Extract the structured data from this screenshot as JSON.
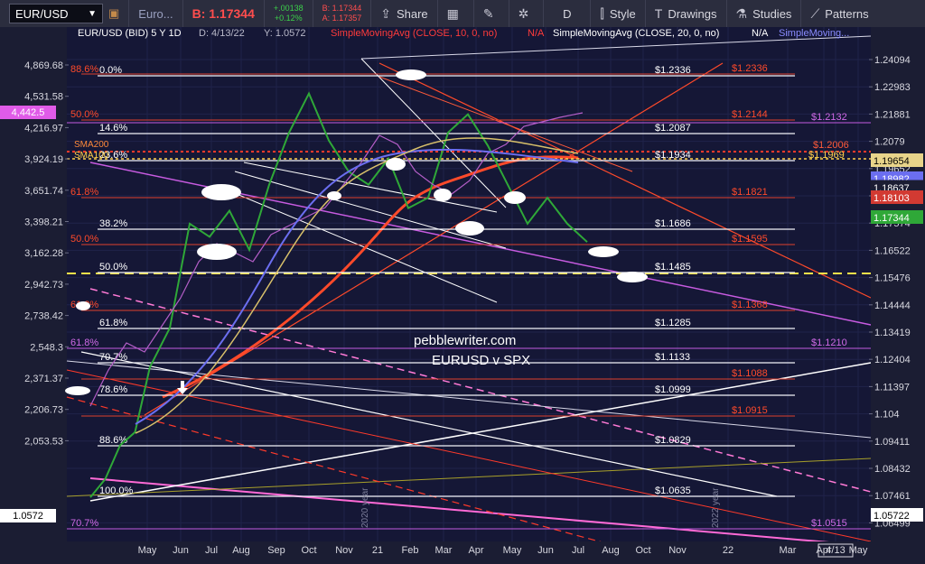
{
  "toolbar": {
    "symbol": "EUR/USD",
    "pair_short": "Euro...",
    "bid_label": "B: 1.17344",
    "change_up": "+.00138",
    "change_pct": "+0.12%",
    "bid_small": "B: 1.17344",
    "ask_small": "A: 1.17357",
    "share": "Share",
    "period": "D",
    "style": "Style",
    "drawings": "Drawings",
    "studies": "Studies",
    "patterns": "Patterns"
  },
  "header": {
    "title": "EUR/USD (BID) 5 Y 1D",
    "date": "D: 4/13/22",
    "value": "Y: 1.0572",
    "study1": "SimpleMovingAvg (CLOSE, 10, 0, no)",
    "study1_val": "N/A",
    "study2": "SimpleMovingAvg (CLOSE, 20, 0, no)",
    "study2_val": "N/A",
    "study3": "SimpleMoving..."
  },
  "watermark": {
    "line1": "pebblewriter.com",
    "line2": "EURUSD v SPX"
  },
  "fib_lines": [
    {
      "pct": "0.0%",
      "price": "$1.2336",
      "red": "$1.2336"
    },
    {
      "pct": "14.6%",
      "price": "$1.2087",
      "red": ""
    },
    {
      "pct": "23.6%",
      "price": "$1.1934",
      "red": ""
    },
    {
      "pct": "38.2%",
      "price": "$1.1686",
      "red": ""
    },
    {
      "pct": "50.0%",
      "price": "$1.1485",
      "red": ""
    },
    {
      "pct": "61.8%",
      "price": "$1.1285",
      "red": ""
    },
    {
      "pct": "70.7%",
      "price": "$1.1133",
      "red": ""
    },
    {
      "pct": "78.6%",
      "price": "$1.0999",
      "red": ""
    },
    {
      "pct": "88.6%",
      "price": "$1.0829",
      "red": ""
    },
    {
      "pct": "100.0%",
      "price": "$1.0635",
      "red": "$1.0635"
    }
  ],
  "red_fibs": [
    {
      "pct": "88.6%",
      "price": "$1.2336"
    },
    {
      "pct": "50.0%",
      "price": "$1.2144"
    },
    {
      "pct": "61.8%",
      "price": "$1.1821"
    },
    {
      "pct": "50.0%",
      "price": "$1.1595"
    },
    {
      "pct": "61.2%",
      "price": "$1.1368"
    },
    {
      "pct": "",
      "price": "$1.1088"
    },
    {
      "pct": "",
      "price": "$1.0915"
    }
  ],
  "magenta_fibs": [
    {
      "pct": "",
      "price": "$1.2132"
    },
    {
      "pct": "61.8%",
      "price": "$1.1210"
    },
    {
      "pct": "70.7%",
      "price": "$1.0515"
    }
  ],
  "sma_labels": {
    "sma200": "SMA200",
    "sma100": "SMA100",
    "sma200_val": "$1.2006",
    "sma100_val": "$1.1969"
  },
  "year_labels": [
    "2020 year",
    "2022 year"
  ],
  "chart_data": {
    "type": "line",
    "title": "EUR/USD (BID) 5 Y 1D",
    "left_axis": {
      "series": "SPX",
      "ticks": [
        "4,869.68",
        "4,531.58",
        "4,216.97",
        "3,924.19",
        "3,651.74",
        "3,398.21",
        "3,162.28",
        "2,942.73",
        "2,738.42",
        "2,548.3",
        "2,371.37",
        "2,206.73",
        "2,053.53"
      ],
      "current": "4,442.5",
      "current_low": "1.0572"
    },
    "right_axis": {
      "series": "EUR/USD",
      "ticks": [
        "1.24094",
        "1.22983",
        "1.21881",
        "1.2079",
        "1.19652",
        "1.18637",
        "1.17574",
        "1.16522",
        "1.15476",
        "1.14444",
        "1.13419",
        "1.12404",
        "1.11397",
        "1.104",
        "1.09411",
        "1.08432",
        "1.07461",
        "1.06499"
      ],
      "badges": [
        {
          "text": "1.19654",
          "color": "#e8d48a"
        },
        {
          "text": "1.18982",
          "color": "#6b6ef0"
        },
        {
          "text": "1.18637",
          "color": "#1b1d33"
        },
        {
          "text": "1.18103",
          "color": "#d23a32"
        },
        {
          "text": "1.17344",
          "color": "#2fa838"
        },
        {
          "text": "1.05722",
          "color": "#ffffff"
        }
      ]
    },
    "x_labels": [
      "May",
      "Jun",
      "Jul",
      "Aug",
      "Sep",
      "Oct",
      "Nov",
      "21",
      "Feb",
      "Mar",
      "Apr",
      "May",
      "Jun",
      "Jul",
      "Aug",
      "Oct",
      "Nov",
      "22",
      "Mar",
      "Apr",
      "4/13",
      "May"
    ],
    "series": [
      {
        "name": "EUR/USD",
        "color": "#2fa838",
        "points": [
          [
            0.0,
            1.075
          ],
          [
            0.03,
            1.082
          ],
          [
            0.06,
            1.095
          ],
          [
            0.09,
            1.1
          ],
          [
            0.12,
            1.125
          ],
          [
            0.16,
            1.14
          ],
          [
            0.2,
            1.18
          ],
          [
            0.24,
            1.175
          ],
          [
            0.28,
            1.185
          ],
          [
            0.32,
            1.17
          ],
          [
            0.36,
            1.195
          ],
          [
            0.4,
            1.215
          ],
          [
            0.44,
            1.23
          ],
          [
            0.48,
            1.212
          ],
          [
            0.52,
            1.2
          ],
          [
            0.56,
            1.195
          ],
          [
            0.6,
            1.205
          ],
          [
            0.64,
            1.186
          ],
          [
            0.68,
            1.19
          ],
          [
            0.72,
            1.215
          ],
          [
            0.76,
            1.222
          ],
          [
            0.8,
            1.21
          ],
          [
            0.84,
            1.195
          ],
          [
            0.88,
            1.18
          ],
          [
            0.92,
            1.19
          ],
          [
            0.96,
            1.18
          ],
          [
            1.0,
            1.173
          ]
        ]
      },
      {
        "name": "SPX",
        "color": "#b45ec8",
        "points": []
      }
    ]
  }
}
